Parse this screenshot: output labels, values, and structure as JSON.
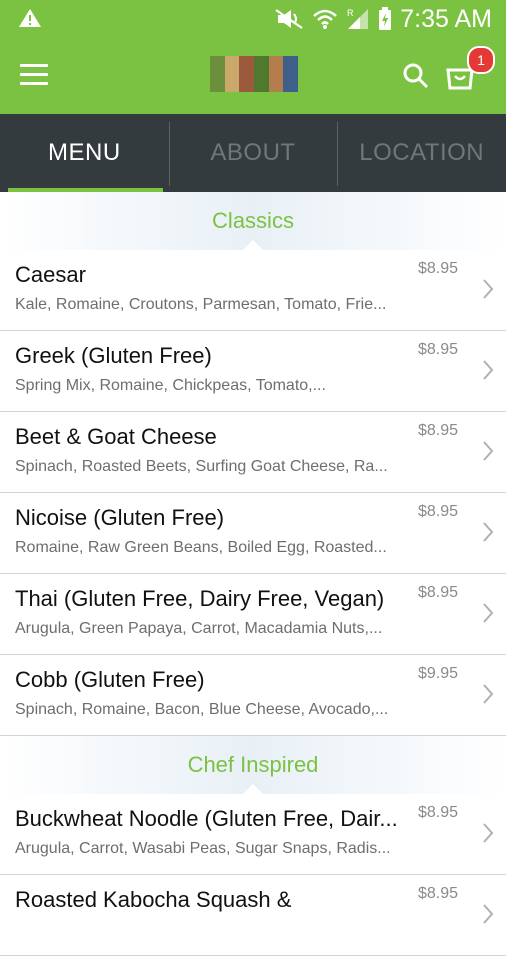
{
  "status_bar": {
    "time": "7:35 AM",
    "icons": [
      "warning-icon",
      "mute-icon",
      "wifi-icon",
      "signal-icon",
      "battery-icon"
    ]
  },
  "app_bar": {
    "icons": [
      "menu-icon",
      "search-icon",
      "cart-icon"
    ],
    "cart_count": "1"
  },
  "tabs": [
    {
      "label": "MENU",
      "active": true
    },
    {
      "label": "ABOUT",
      "active": false
    },
    {
      "label": "LOCATION",
      "active": false
    }
  ],
  "sections": [
    {
      "title": "Classics",
      "items": [
        {
          "name": "Caesar",
          "description": "Kale, Romaine, Croutons, Parmesan, Tomato, Frie...",
          "price": "$8.95"
        },
        {
          "name": "Greek (Gluten Free)",
          "description": "Spring Mix, Romaine, Chickpeas, Tomato,...",
          "price": "$8.95"
        },
        {
          "name": "Beet & Goat Cheese",
          "description": "Spinach, Roasted Beets, Surfing Goat Cheese, Ra...",
          "price": "$8.95"
        },
        {
          "name": "Nicoise (Gluten Free)",
          "description": "Romaine, Raw Green Beans, Boiled Egg, Roasted...",
          "price": "$8.95"
        },
        {
          "name": "Thai (Gluten Free, Dairy Free, Vegan)",
          "description": "Arugula, Green Papaya, Carrot, Macadamia Nuts,...",
          "price": "$8.95"
        },
        {
          "name": "Cobb (Gluten Free)",
          "description": "Spinach, Romaine, Bacon, Blue Cheese, Avocado,...",
          "price": "$9.95"
        }
      ]
    },
    {
      "title": "Chef Inspired",
      "items": [
        {
          "name": "Buckwheat Noodle (Gluten Free, Dair...",
          "description": "Arugula, Carrot, Wasabi Peas, Sugar Snaps, Radis...",
          "price": "$8.95"
        },
        {
          "name": "Roasted Kabocha Squash &",
          "description": "",
          "price": "$8.95"
        }
      ]
    }
  ],
  "colors": {
    "brand_green": "#7cc242",
    "tab_bar": "#333b3f",
    "badge_red": "#e53935"
  }
}
